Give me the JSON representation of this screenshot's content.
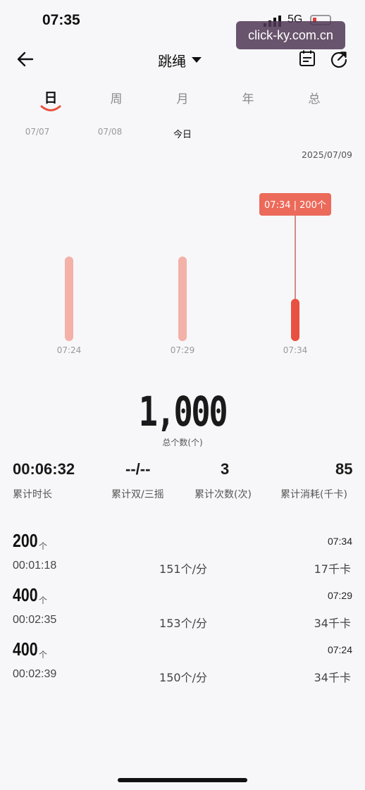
{
  "status_bar": {
    "time": "07:35",
    "network": "5G",
    "watermark": "click-ky.com.cn"
  },
  "header": {
    "title": "跳绳",
    "icons": {
      "back": "back-arrow-icon",
      "menu": "dropdown-caret-icon",
      "calendar": "calendar-icon",
      "share": "share-icon"
    }
  },
  "tabs": [
    {
      "label": "日",
      "active": true
    },
    {
      "label": "周",
      "active": false
    },
    {
      "label": "月",
      "active": false
    },
    {
      "label": "年",
      "active": false
    },
    {
      "label": "总",
      "active": false
    }
  ],
  "dates": [
    {
      "label": "07/07"
    },
    {
      "label": "07/08"
    },
    {
      "label": "今日"
    }
  ],
  "chart_date": "2025/07/09",
  "chart_data": {
    "type": "bar",
    "categories": [
      "07:24",
      "07:29",
      "07:34"
    ],
    "values": [
      400,
      400,
      200
    ],
    "selected_index": 2,
    "tooltip": "07:34 | 200个",
    "colors": {
      "bar": "#f2a59a",
      "selected": "#e8503f",
      "tooltip": "#ec6a5a"
    }
  },
  "summary": {
    "total_value": "1,000",
    "total_label": "总个数(个)",
    "stats": [
      {
        "value": "00:06:32",
        "label": "累计时长"
      },
      {
        "value": "--/--",
        "label": "累计双/三摇"
      },
      {
        "value": "3",
        "label": "累计次数(次)"
      },
      {
        "value": "85",
        "label": "累计消耗(千卡)"
      }
    ]
  },
  "records": [
    {
      "count": "200",
      "unit": "个",
      "time": "07:34",
      "duration": "00:01:18",
      "rate": "151个/分",
      "calories": "17千卡"
    },
    {
      "count": "400",
      "unit": "个",
      "time": "07:29",
      "duration": "00:02:35",
      "rate": "153个/分",
      "calories": "34千卡"
    },
    {
      "count": "400",
      "unit": "个",
      "time": "07:24",
      "duration": "00:02:39",
      "rate": "150个/分",
      "calories": "34千卡"
    }
  ]
}
